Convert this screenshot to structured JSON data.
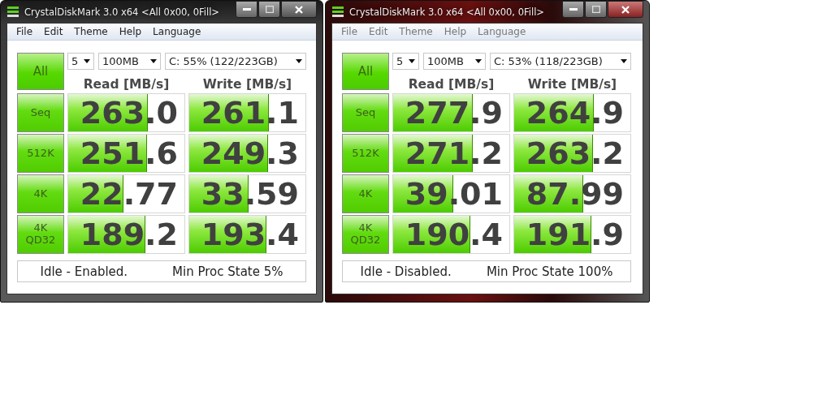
{
  "windows": [
    {
      "title": "CrystalDiskMark 3.0 x64 <All 0x00, 0Fill>",
      "active": true,
      "menu": [
        "File",
        "Edit",
        "Theme",
        "Help",
        "Language"
      ],
      "all_button": "All",
      "count": "5",
      "size": "100MB",
      "drive": "C: 55% (122/223GB)",
      "columns": [
        "Read [MB/s]",
        "Write [MB/s]"
      ],
      "rows": [
        {
          "label": "Seq",
          "read": {
            "value": "263.0",
            "level": 0.68
          },
          "write": {
            "value": "261.1",
            "level": 0.68
          }
        },
        {
          "label": "512K",
          "read": {
            "value": "251.6",
            "level": 0.67
          },
          "write": {
            "value": "249.3",
            "level": 0.67
          }
        },
        {
          "label": "4K",
          "read": {
            "value": "22.77",
            "level": 0.47
          },
          "write": {
            "value": "33.59",
            "level": 0.5
          }
        },
        {
          "label": "4K\nQD32",
          "read": {
            "value": "189.2",
            "level": 0.66
          },
          "write": {
            "value": "193.4",
            "level": 0.66
          }
        }
      ],
      "status": [
        "Idle - Enabled.",
        "Min Proc State 5%"
      ]
    },
    {
      "title": "CrystalDiskMark 3.0 x64 <All 0x00, 0Fill>",
      "active": false,
      "menu": [
        "File",
        "Edit",
        "Theme",
        "Help",
        "Language"
      ],
      "all_button": "All",
      "count": "5",
      "size": "100MB",
      "drive": "C: 53% (118/223GB)",
      "columns": [
        "Read [MB/s]",
        "Write [MB/s]"
      ],
      "rows": [
        {
          "label": "Seq",
          "read": {
            "value": "277.9",
            "level": 0.68
          },
          "write": {
            "value": "264.9",
            "level": 0.68
          }
        },
        {
          "label": "512K",
          "read": {
            "value": "271.2",
            "level": 0.68
          },
          "write": {
            "value": "263.2",
            "level": 0.67
          }
        },
        {
          "label": "4K",
          "read": {
            "value": "39.01",
            "level": 0.51
          },
          "write": {
            "value": "87.99",
            "level": 0.59
          }
        },
        {
          "label": "4K\nQD32",
          "read": {
            "value": "190.4",
            "level": 0.66
          },
          "write": {
            "value": "191.9",
            "level": 0.66
          }
        }
      ],
      "status": [
        "Idle - Disabled.",
        "Min Proc State 100%"
      ]
    }
  ]
}
